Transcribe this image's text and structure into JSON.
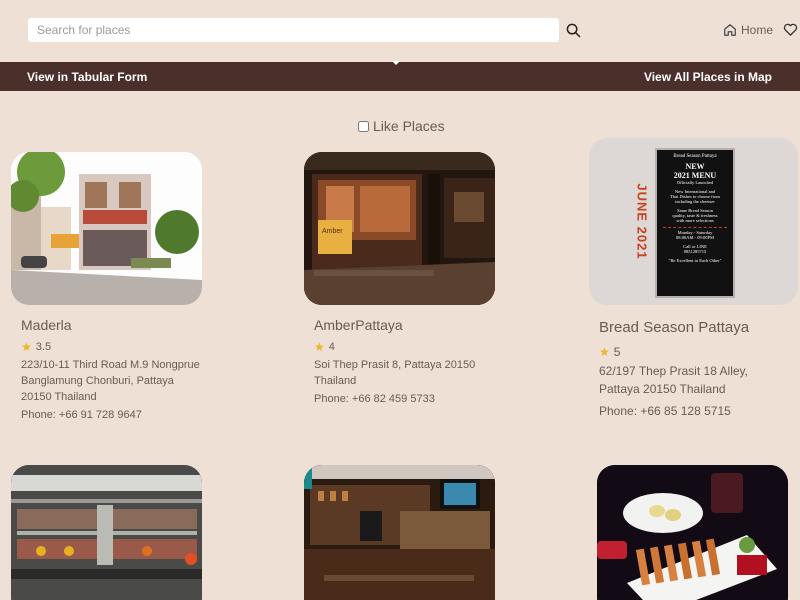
{
  "header": {
    "search_placeholder": "Search for places",
    "home_label": "Home"
  },
  "navbar": {
    "tabular_label": "View in Tabular Form",
    "map_label": "View All Places in Map"
  },
  "filter": {
    "like_places_label": "Like Places"
  },
  "cards": [
    {
      "name": "Maderla",
      "rating": "3.5",
      "address": "223/10-11 Third Road M.9 Nongprue Banglamung Chonburi, Pattaya 20150 Thailand",
      "phone": "Phone: +66 91 728 9647"
    },
    {
      "name": "AmberPattaya",
      "rating": "4",
      "address": "Soi Thep Prasit 8, Pattaya 20150 Thailand",
      "phone": "Phone: +66 82 459 5733"
    },
    {
      "name": "Bread Season Pattaya",
      "rating": "5",
      "address": "62/197 Thep Prasit 18 Alley, Pattaya 20150 Thailand",
      "phone": "Phone: +66 85 128 5715"
    }
  ],
  "poster": {
    "side_text": "JUNE 2021",
    "brand": "Bread Season Pattaya",
    "headline_1": "NEW",
    "headline_2": "2021 MENU",
    "headline_3": "Officially Launched",
    "line_1": "New International and",
    "line_2": "Thai Dishes to choose from",
    "line_3": "including the cheeiser",
    "line_4": "Same Bread Season",
    "line_5": "quality, taste & freshness",
    "line_6": "with more selections",
    "hours_1": "Monday - Saturday",
    "hours_2": "08:00AM - 09:00PM",
    "contact_1": "Call or LINE",
    "contact_2": "0851285715",
    "tagline": "\"Be Excellent to Each Other\""
  },
  "storefront_sign": "Amber",
  "colors": {
    "background": "#efe0d6",
    "navbar": "#4a2f2a",
    "text": "#6b5a52",
    "star": "#f0b429"
  },
  "icons": {
    "search": "search-icon",
    "home": "home-icon",
    "heart": "heart-icon",
    "star": "star-icon"
  }
}
